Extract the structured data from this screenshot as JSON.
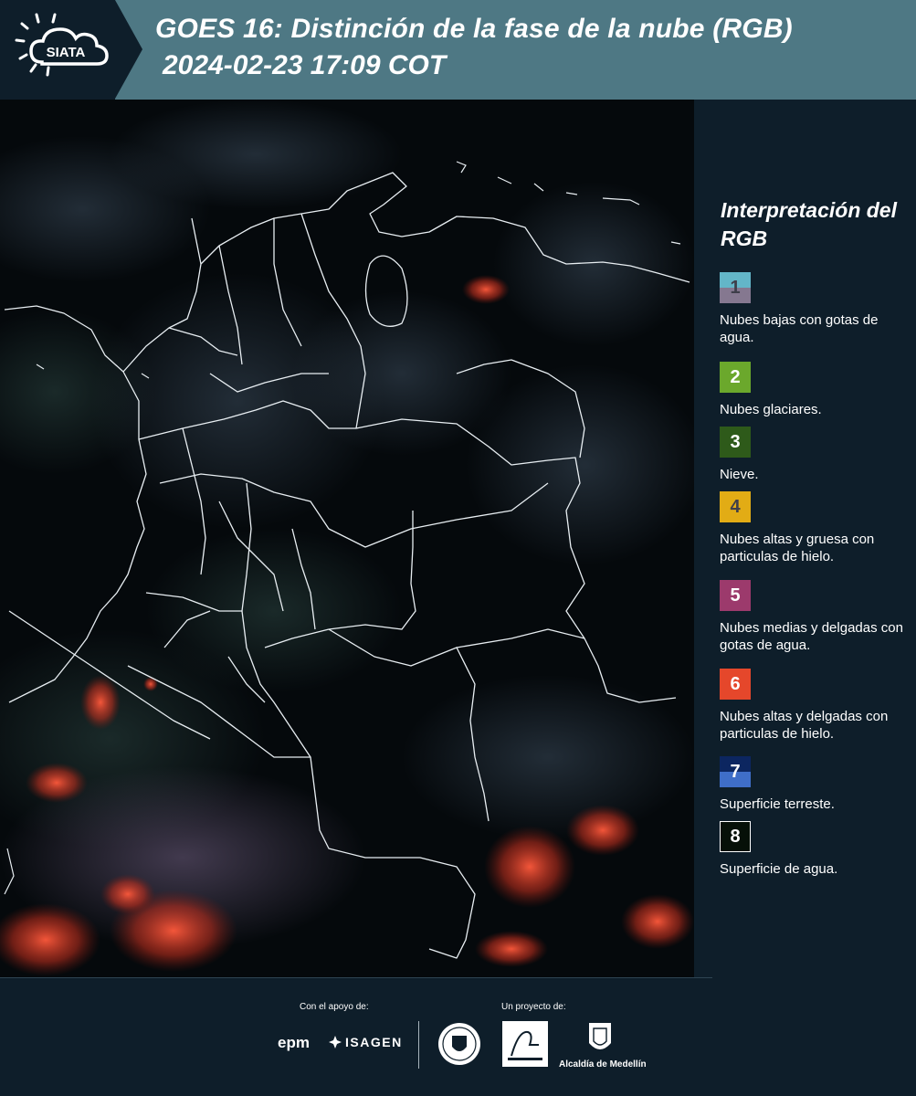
{
  "header": {
    "logo_text": "SIATA",
    "title": "GOES 16: Distinción de la fase de la nube (RGB)",
    "subtitle": "2024-02-23 17:09 COT",
    "bar_color": "#4e7884"
  },
  "legend": {
    "title": "Interpretación del RGB",
    "items": [
      {
        "number": "1",
        "label": "Nubes bajas con gotas de agua.",
        "color_top": "#63b6c8",
        "color_bottom": "#857890"
      },
      {
        "number": "2",
        "label": "Nubes glaciares.",
        "color": "#6ba82c"
      },
      {
        "number": "3",
        "label": "Nieve.",
        "color": "#2e5a1a"
      },
      {
        "number": "4",
        "label": "Nubes altas y gruesa con particulas de hielo.",
        "color": "#e2ac15"
      },
      {
        "number": "5",
        "label": "Nubes medias y delgadas con gotas de agua.",
        "color": "#9c3a6c"
      },
      {
        "number": "6",
        "label": "Nubes altas y delgadas con particulas de hielo.",
        "color": "#e5472b"
      },
      {
        "number": "7",
        "label": "Superficie terreste.",
        "color_top": "#0c2660",
        "color_bottom": "#3f6ec8"
      },
      {
        "number": "8",
        "label": "Superficie de agua.",
        "color": "#061008"
      }
    ]
  },
  "footer": {
    "support_label": "Con el apoyo de:",
    "project_label": "Un proyecto de:",
    "sponsor_1": "epm",
    "sponsor_2": "ISAGEN",
    "partner_3": "Alcaldía de Medellín"
  }
}
